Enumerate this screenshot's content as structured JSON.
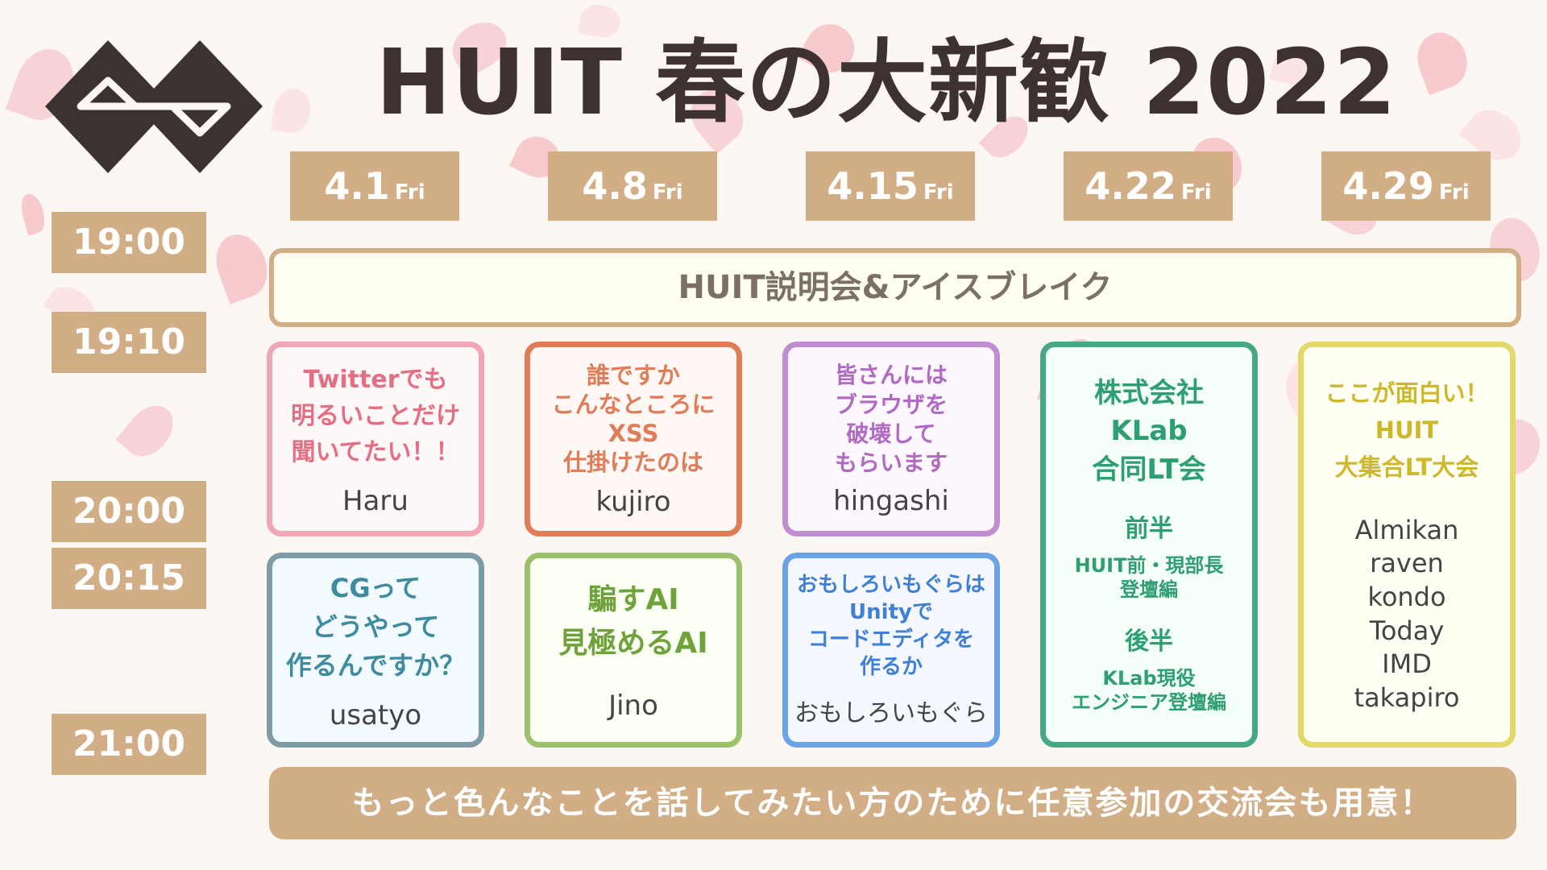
{
  "title": "HUIT 春の大新歓 2022",
  "dates": [
    {
      "date": "4.1",
      "day": "Fri"
    },
    {
      "date": "4.8",
      "day": "Fri"
    },
    {
      "date": "4.15",
      "day": "Fri"
    },
    {
      "date": "4.22",
      "day": "Fri"
    },
    {
      "date": "4.29",
      "day": "Fri"
    }
  ],
  "times": [
    "19:00",
    "19:10",
    "20:00",
    "20:15",
    "21:00"
  ],
  "banner": "HUIT説明会&アイスブレイク",
  "sessions": {
    "d1_a": {
      "title": "Twitterでも\n明るいことだけ\n聞いてたい！！",
      "speaker": "Haru"
    },
    "d1_b": {
      "title": "CGって\nどうやって\n作るんですか？",
      "speaker": "usatyo"
    },
    "d2_a": {
      "title": "誰ですか\nこんなところに\nXSS\n仕掛けたのは",
      "speaker": "kujiro"
    },
    "d2_b": {
      "title": "騙すAI\n見極めるAI",
      "speaker": "Jino"
    },
    "d3_a": {
      "title": "皆さんには\nブラウザを\n破壊して\nもらいます",
      "speaker": "hingashi"
    },
    "d3_b": {
      "title": "おもしろいもぐらは\nUnityで\nコードエディタを\n作るか",
      "speaker": "おもしろいもぐら"
    },
    "d4": {
      "title": "株式会社\nKLab\n合同LT会",
      "part1_label": "前半",
      "part1_desc": "HUIT前・現部長\n登壇編",
      "part2_label": "後半",
      "part2_desc": "KLab現役\nエンジニア登壇編"
    },
    "d5": {
      "title": "ここが面白い！\nHUIT\n大集合LT大会",
      "speakers": "Almikan\nraven\nkondo\nToday\nIMD\ntakapiro"
    }
  },
  "footer": "もっと色んなことを話してみたい方のために任意参加の交流会も用意！",
  "colors": {
    "accent": "#d1ae86",
    "title": "#3e3230",
    "pink": "#e46f83",
    "orange": "#e07d58",
    "purple": "#b06ac2",
    "teal": "#3e8a9f",
    "green": "#7fab44",
    "blue": "#3f7fd6",
    "emerald": "#2e9e74",
    "yellow": "#d9c93a"
  }
}
